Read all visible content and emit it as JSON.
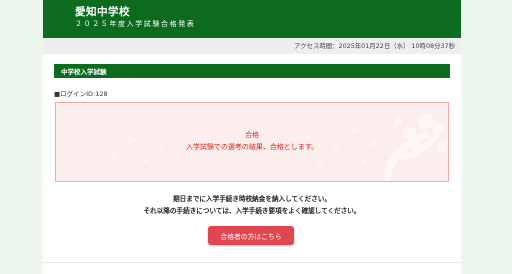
{
  "header": {
    "school_name": "愛知中学校",
    "subtitle": "２０２５年度入学試験合格発表"
  },
  "access": {
    "text": "アクセス時間：2025年01月22日（水） 10時08分37秒"
  },
  "section": {
    "title": "中学校入学試験"
  },
  "login": {
    "text": "■ログインID:128"
  },
  "result": {
    "title": "合格",
    "message": "入学試験での選考の結果、合格とします。"
  },
  "notices": [
    "期日までに入学手続き時校納金を納入してください。",
    "それ以降の手続きについては、入学手続き要項をよく確認してください。"
  ],
  "button": {
    "label": "合格者の方はこちら"
  },
  "colors": {
    "header_green": "#0d6b1f",
    "result_red": "#e02020",
    "button_red": "#e0464f",
    "result_bg": "#fdeeee"
  }
}
